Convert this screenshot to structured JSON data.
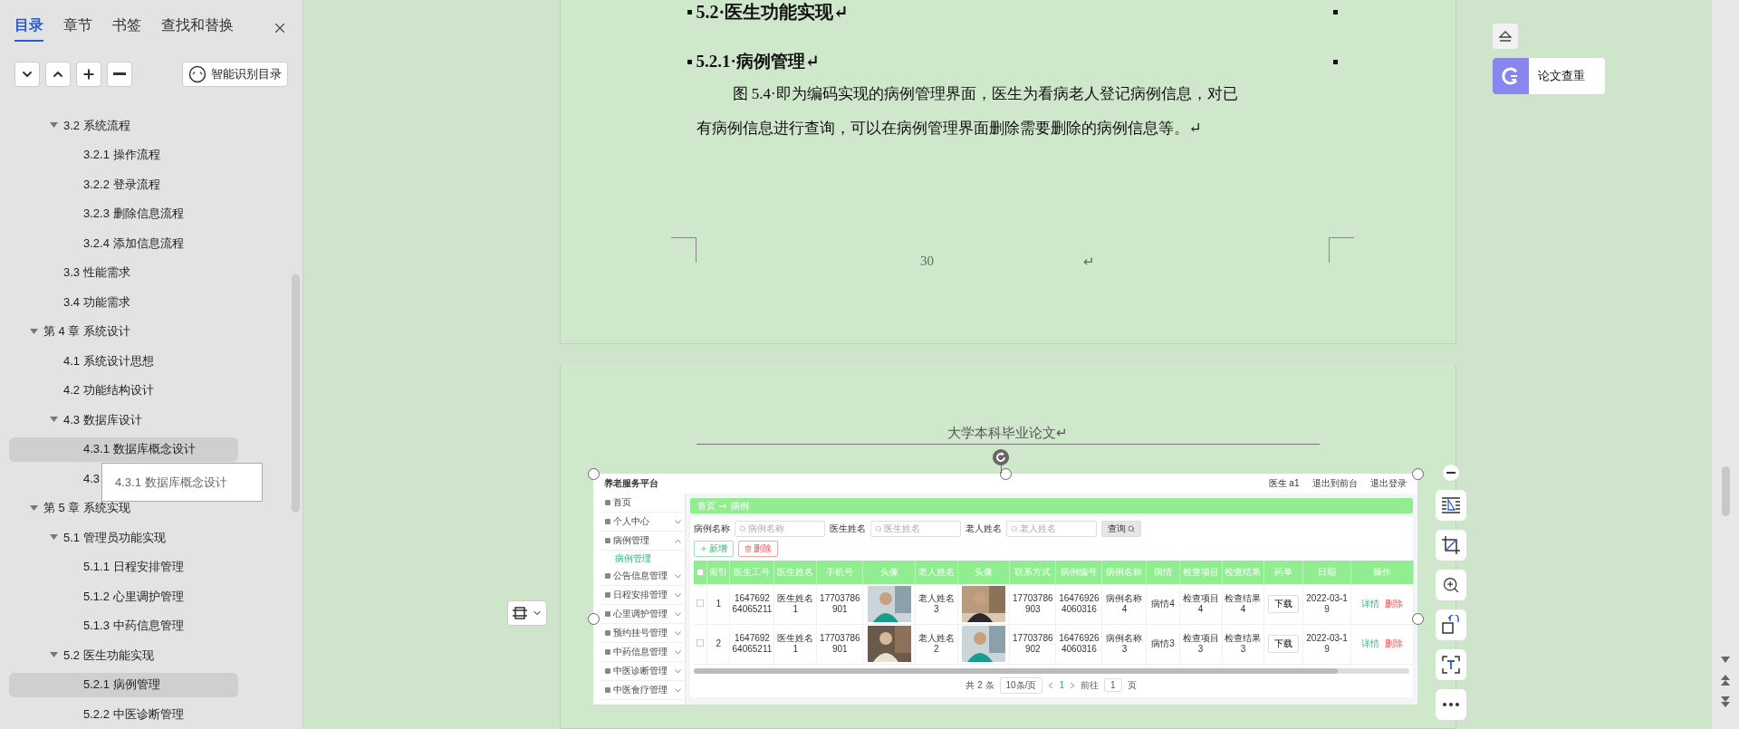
{
  "sidebar": {
    "tabs": [
      {
        "label": "目录",
        "selected": true
      },
      {
        "label": "章节",
        "selected": false
      },
      {
        "label": "书签",
        "selected": false
      },
      {
        "label": "查找和替换",
        "selected": false
      }
    ],
    "smart_button": "智能识别目录",
    "toc": [
      {
        "children": [
          {
            "label": "3.2  系统流程",
            "expanded": true,
            "selected": false,
            "hovered": false,
            "children": [
              {
                "label": "3.2.1  操作流程",
                "selected": false,
                "hovered": false
              },
              {
                "label": "3.2.2  登录流程",
                "selected": false,
                "hovered": false
              },
              {
                "label": "3.2.3  删除信息流程",
                "selected": false,
                "hovered": false
              },
              {
                "label": "3.2.4  添加信息流程",
                "selected": false,
                "hovered": false
              }
            ]
          },
          {
            "label": "3.3  性能需求",
            "selected": false,
            "hovered": false
          },
          {
            "label": "3.4  功能需求",
            "selected": false,
            "hovered": false
          }
        ]
      },
      {
        "label": "第 4 章  系统设计",
        "expanded": true,
        "selected": false,
        "hovered": false,
        "children": [
          {
            "label": "4.1  系统设计思想",
            "selected": false,
            "hovered": false
          },
          {
            "label": "4.2  功能结构设计",
            "selected": false,
            "hovered": false
          },
          {
            "label": "4.3  数据库设计",
            "expanded": true,
            "selected": false,
            "hovered": false,
            "children": [
              {
                "label": "4.3.1  数据库概念设计",
                "selected": false,
                "hovered": true
              },
              {
                "label": "4.3",
                "selected": false,
                "hovered": false
              }
            ]
          }
        ]
      },
      {
        "label": "第 5 章  系统实现",
        "expanded": true,
        "selected": false,
        "hovered": false,
        "children": [
          {
            "label": "5.1  管理员功能实现",
            "expanded": true,
            "selected": false,
            "hovered": false,
            "children": [
              {
                "label": "5.1.1  日程安排管理",
                "selected": false,
                "hovered": false
              },
              {
                "label": "5.1.2  心里调护管理",
                "selected": false,
                "hovered": false
              },
              {
                "label": "5.1.3  中药信息管理",
                "selected": false,
                "hovered": false
              }
            ]
          },
          {
            "label": "5.2  医生功能实现",
            "expanded": true,
            "selected": false,
            "hovered": false,
            "children": [
              {
                "label": "5.2.1  病例管理",
                "selected": true,
                "hovered": false
              },
              {
                "label": "5.2.2  中医诊断管理",
                "selected": false,
                "hovered": false
              }
            ]
          }
        ]
      }
    ],
    "tooltip": "4.3.1 数据库概念设计"
  },
  "document": {
    "heading_1": "5.2·医生功能实现↵",
    "heading_2": "5.2.1·病例管理↵",
    "paragraph_lines": [
      "图 5.4·即为编码实现的病例管理界面，医生为看病老人登记病例信息，对已",
      "有病例信息进行查询，可以在病例管理界面删除需要删除的病例信息等。↵"
    ],
    "page_number": "30",
    "page_end_mark": "↵",
    "page_header": "大学本科毕业论文↵",
    "figure": {
      "app_title": "养老服务平台",
      "top_links": [
        "医生 a1",
        "退出到前台",
        "退出登录"
      ],
      "menu": [
        {
          "kind": "link",
          "label": "首页"
        },
        {
          "kind": "group",
          "label": "个人中心",
          "expanded": false
        },
        {
          "kind": "group",
          "label": "病例管理",
          "expanded": true,
          "children": [
            {
              "label": "病例管理",
              "selected": true
            }
          ]
        },
        {
          "kind": "group",
          "label": "公告信息管理",
          "expanded": false
        },
        {
          "kind": "group",
          "label": "日程安排管理",
          "expanded": false
        },
        {
          "kind": "group",
          "label": "心里调护管理",
          "expanded": false
        },
        {
          "kind": "group",
          "label": "预约挂号管理",
          "expanded": false
        },
        {
          "kind": "group",
          "label": "中药信息管理",
          "expanded": false
        },
        {
          "kind": "group",
          "label": "中医诊断管理",
          "expanded": false
        },
        {
          "kind": "group",
          "label": "中医食疗管理",
          "expanded": false
        }
      ],
      "breadcrumb": [
        "首页",
        "病例"
      ],
      "filters": [
        {
          "label": "病例名称",
          "placeholder": "病例名称"
        },
        {
          "label": "医生姓名",
          "placeholder": "医生姓名"
        },
        {
          "label": "老人姓名",
          "placeholder": "老人姓名"
        }
      ],
      "search_button": "查询",
      "select_all_checked": false,
      "actions": [
        {
          "kind": "add",
          "label": "新增"
        },
        {
          "kind": "delete",
          "label": "删除"
        }
      ],
      "columns": [
        "索引",
        "医生工号",
        "医生姓名",
        "手机号",
        "头像",
        "老人姓名",
        "头像",
        "联系方式",
        "病例编号",
        "病例名称",
        "病情",
        "检查项目",
        "检查结果",
        "药单",
        "日期",
        "操作"
      ],
      "rows": [
        {
          "checked": false,
          "cells": [
            {
              "kind": "text",
              "text": "1"
            },
            {
              "kind": "text",
              "text": "164769264065211"
            },
            {
              "kind": "text",
              "text": "医生姓名1"
            },
            {
              "kind": "text",
              "text": "17703786901"
            },
            {
              "kind": "picture"
            },
            {
              "kind": "text",
              "text": "老人姓名3"
            },
            {
              "kind": "picture"
            },
            {
              "kind": "text",
              "text": "17703786903"
            },
            {
              "kind": "text",
              "text": "164769264060316"
            },
            {
              "kind": "text",
              "text": "病例名称4"
            },
            {
              "kind": "text",
              "text": "病情4"
            },
            {
              "kind": "text",
              "text": "检查项目4"
            },
            {
              "kind": "text",
              "text": "检查结果4"
            },
            {
              "kind": "button",
              "text": "下载"
            },
            {
              "kind": "text",
              "text": "2022-03-19"
            },
            {
              "kind": "actions",
              "items": [
                "详情",
                "删除"
              ]
            }
          ]
        },
        {
          "checked": false,
          "cells": [
            {
              "kind": "text",
              "text": "2"
            },
            {
              "kind": "text",
              "text": "164769264065211"
            },
            {
              "kind": "text",
              "text": "医生姓名1"
            },
            {
              "kind": "text",
              "text": "17703786901"
            },
            {
              "kind": "picture"
            },
            {
              "kind": "text",
              "text": "老人姓名2"
            },
            {
              "kind": "picture"
            },
            {
              "kind": "text",
              "text": "17703786902"
            },
            {
              "kind": "text",
              "text": "164769264060316"
            },
            {
              "kind": "text",
              "text": "病例名称3"
            },
            {
              "kind": "text",
              "text": "病情3"
            },
            {
              "kind": "text",
              "text": "检查项目3"
            },
            {
              "kind": "text",
              "text": "检查结果3"
            },
            {
              "kind": "button",
              "text": "下载"
            },
            {
              "kind": "text",
              "text": "2022-03-19"
            },
            {
              "kind": "actions",
              "items": [
                "详情",
                "删除"
              ]
            }
          ]
        }
      ],
      "pagination": {
        "total": "共 2 条",
        "page_size": "10条/页",
        "page": "1",
        "goto_label": "前往",
        "goto_value": "1",
        "goto_suffix": "页"
      }
    }
  },
  "side_panel": {
    "check_button": "论文查重"
  }
}
